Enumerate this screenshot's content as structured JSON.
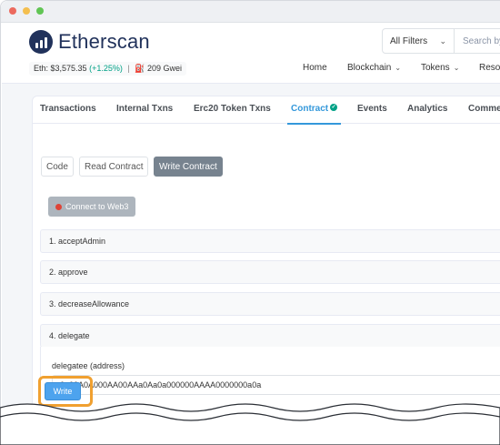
{
  "window": {
    "controls": [
      "#ec6a5e",
      "#f4bf4f",
      "#61c554"
    ]
  },
  "header": {
    "brand": "Etherscan",
    "price_label": "Eth: $3,575.35",
    "price_change": "(+1.25%)",
    "separator": "|",
    "gas_label": "209 Gwei",
    "filter_value": "All Filters",
    "search_placeholder": "Search by",
    "nav": [
      {
        "label": "Home"
      },
      {
        "label": "Blockchain"
      },
      {
        "label": "Tokens"
      },
      {
        "label": "Resou"
      }
    ]
  },
  "tabs": [
    {
      "label": "Transactions"
    },
    {
      "label": "Internal Txns"
    },
    {
      "label": "Erc20 Token Txns"
    },
    {
      "label": "Contract"
    },
    {
      "label": "Events"
    },
    {
      "label": "Analytics"
    },
    {
      "label": "Comme"
    }
  ],
  "subtabs": [
    {
      "label": "Code"
    },
    {
      "label": "Read Contract"
    },
    {
      "label": "Write Contract"
    }
  ],
  "connect_label": "Connect to Web3",
  "functions": [
    {
      "label": "1. acceptAdmin"
    },
    {
      "label": "2. approve"
    },
    {
      "label": "3. decreaseAllowance"
    },
    {
      "label": "4. delegate"
    }
  ],
  "delegate": {
    "param_label": "delegatee (address)",
    "param_value": "0a00A0A000AA00AAa0Aa0a000000AAAA0000000a0a",
    "write_label": "Write"
  },
  "colors": {
    "accent": "#3498db",
    "brand": "#21325b",
    "highlight": "#f0a030",
    "positive": "#00a186"
  }
}
